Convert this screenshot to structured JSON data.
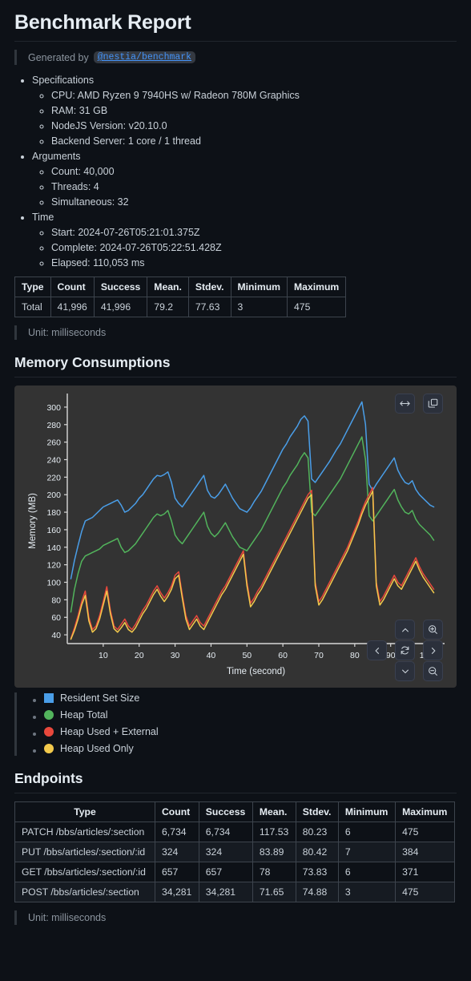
{
  "report": {
    "title": "Benchmark Report",
    "generated_by_label": "Generated by",
    "generated_by_package": "@nestia/benchmark"
  },
  "specifications": {
    "heading": "Specifications",
    "items": [
      "CPU: AMD Ryzen 9 7940HS w/ Radeon 780M Graphics",
      "RAM: 31 GB",
      "NodeJS Version: v20.10.0",
      "Backend Server: 1 core / 1 thread"
    ]
  },
  "arguments": {
    "heading": "Arguments",
    "items": [
      "Count: 40,000",
      "Threads: 4",
      "Simultaneous: 32"
    ]
  },
  "time": {
    "heading": "Time",
    "items": [
      "Start: 2024-07-26T05:21:01.375Z",
      "Complete: 2024-07-26T05:22:51.428Z",
      "Elapsed: 110,053 ms"
    ]
  },
  "summary_table": {
    "columns": [
      "Type",
      "Count",
      "Success",
      "Mean.",
      "Stdev.",
      "Minimum",
      "Maximum"
    ],
    "rows": [
      [
        "Total",
        "41,996",
        "41,996",
        "79.2",
        "77.63",
        "3",
        "475"
      ]
    ],
    "unit_note": "Unit: milliseconds"
  },
  "memory": {
    "heading": "Memory Consumptions",
    "toolbar": {
      "resize_label": "resize",
      "copy_label": "copy"
    },
    "nav": {
      "up": "up",
      "down": "down",
      "left": "left",
      "right": "right",
      "reset": "reset",
      "zoom_in": "zoom in",
      "zoom_out": "zoom out"
    },
    "legend": [
      {
        "label": "Resident Set Size",
        "color": "#4a9ee8",
        "shape": "square"
      },
      {
        "label": "Heap Total",
        "color": "#52b45c",
        "shape": "circle"
      },
      {
        "label": "Heap Used + External",
        "color": "#e8483c",
        "shape": "circle"
      },
      {
        "label": "Heap Used Only",
        "color": "#f2c94c",
        "shape": "circle"
      }
    ]
  },
  "chart_data": {
    "type": "line",
    "title": "Memory Consumptions",
    "xlabel": "Time (second)",
    "ylabel": "Memory (MB)",
    "xlim": [
      0,
      105
    ],
    "ylim": [
      30,
      310
    ],
    "xticks": [
      10,
      20,
      30,
      40,
      50,
      60,
      70,
      80,
      90,
      100
    ],
    "yticks": [
      40,
      60,
      80,
      100,
      120,
      140,
      160,
      180,
      200,
      220,
      240,
      260,
      280,
      300
    ],
    "grid": false,
    "legend_position": "below",
    "x": [
      1,
      2,
      3,
      4,
      5,
      6,
      7,
      8,
      9,
      10,
      11,
      12,
      13,
      14,
      15,
      16,
      17,
      18,
      19,
      20,
      21,
      22,
      23,
      24,
      25,
      26,
      27,
      28,
      29,
      30,
      31,
      32,
      33,
      34,
      35,
      36,
      37,
      38,
      39,
      40,
      41,
      42,
      43,
      44,
      45,
      46,
      47,
      48,
      49,
      50,
      51,
      52,
      53,
      54,
      55,
      56,
      57,
      58,
      59,
      60,
      61,
      62,
      63,
      64,
      65,
      66,
      67,
      68,
      69,
      70,
      71,
      72,
      73,
      74,
      75,
      76,
      77,
      78,
      79,
      80,
      81,
      82,
      83,
      84,
      85,
      86,
      87,
      88,
      89,
      90,
      91,
      92,
      93,
      94,
      95,
      96,
      97,
      98,
      99,
      100,
      101,
      102
    ],
    "series": [
      {
        "name": "Resident Set Size",
        "color": "#4a9ee8",
        "values": [
          104,
          125,
          142,
          158,
          170,
          172,
          174,
          178,
          182,
          186,
          188,
          190,
          192,
          194,
          188,
          180,
          182,
          186,
          190,
          196,
          200,
          206,
          212,
          218,
          222,
          221,
          223,
          226,
          214,
          196,
          190,
          186,
          192,
          198,
          204,
          210,
          216,
          222,
          205,
          198,
          196,
          200,
          206,
          212,
          204,
          196,
          190,
          184,
          182,
          180,
          185,
          192,
          198,
          204,
          212,
          220,
          228,
          236,
          244,
          252,
          258,
          266,
          272,
          278,
          286,
          290,
          284,
          218,
          214,
          220,
          226,
          232,
          238,
          245,
          252,
          258,
          266,
          274,
          282,
          290,
          298,
          306,
          280,
          212,
          205,
          212,
          218,
          224,
          230,
          236,
          242,
          228,
          220,
          214,
          212,
          216,
          206,
          200,
          196,
          192,
          188,
          186
        ]
      },
      {
        "name": "Heap Total",
        "color": "#52b45c",
        "values": [
          66,
          92,
          110,
          124,
          130,
          132,
          134,
          136,
          138,
          142,
          144,
          146,
          148,
          150,
          140,
          134,
          136,
          140,
          144,
          150,
          156,
          162,
          168,
          174,
          178,
          176,
          178,
          182,
          170,
          154,
          148,
          144,
          150,
          156,
          162,
          168,
          174,
          180,
          164,
          156,
          152,
          156,
          162,
          168,
          160,
          152,
          146,
          140,
          138,
          136,
          142,
          148,
          154,
          160,
          168,
          176,
          184,
          192,
          200,
          208,
          214,
          222,
          228,
          234,
          242,
          248,
          242,
          180,
          176,
          182,
          188,
          194,
          200,
          206,
          212,
          218,
          226,
          234,
          242,
          250,
          258,
          266,
          240,
          176,
          170,
          176,
          182,
          188,
          194,
          200,
          206,
          194,
          186,
          180,
          178,
          182,
          172,
          166,
          162,
          158,
          154,
          148
        ]
      },
      {
        "name": "Heap Used + External",
        "color": "#e8483c",
        "values": [
          36,
          48,
          62,
          78,
          90,
          60,
          46,
          50,
          62,
          78,
          95,
          68,
          50,
          46,
          52,
          58,
          50,
          46,
          52,
          60,
          68,
          74,
          82,
          90,
          96,
          88,
          82,
          88,
          96,
          108,
          112,
          86,
          62,
          50,
          56,
          62,
          54,
          50,
          58,
          66,
          74,
          82,
          90,
          96,
          104,
          112,
          120,
          128,
          136,
          100,
          76,
          82,
          90,
          96,
          104,
          112,
          120,
          128,
          136,
          144,
          152,
          160,
          168,
          176,
          184,
          192,
          200,
          205,
          100,
          78,
          84,
          92,
          100,
          108,
          116,
          124,
          132,
          140,
          150,
          160,
          170,
          182,
          192,
          200,
          208,
          100,
          78,
          84,
          92,
          100,
          108,
          100,
          96,
          104,
          112,
          120,
          128,
          118,
          110,
          104,
          98,
          92
        ]
      },
      {
        "name": "Heap Used Only",
        "color": "#f2c94c",
        "values": [
          35,
          45,
          58,
          74,
          85,
          56,
          43,
          47,
          58,
          74,
          90,
          64,
          47,
          43,
          48,
          54,
          46,
          43,
          48,
          56,
          64,
          70,
          78,
          86,
          92,
          84,
          78,
          84,
          92,
          104,
          108,
          82,
          58,
          46,
          52,
          58,
          50,
          46,
          54,
          62,
          70,
          78,
          86,
          92,
          100,
          108,
          116,
          124,
          132,
          96,
          72,
          78,
          86,
          92,
          100,
          108,
          116,
          124,
          132,
          140,
          148,
          156,
          164,
          172,
          180,
          188,
          196,
          200,
          96,
          74,
          80,
          88,
          96,
          104,
          112,
          120,
          128,
          136,
          146,
          156,
          166,
          178,
          188,
          196,
          204,
          96,
          74,
          80,
          88,
          96,
          104,
          96,
          92,
          100,
          108,
          116,
          124,
          114,
          106,
          100,
          94,
          88
        ]
      }
    ]
  },
  "endpoints": {
    "heading": "Endpoints",
    "columns": [
      "Type",
      "Count",
      "Success",
      "Mean.",
      "Stdev.",
      "Minimum",
      "Maximum"
    ],
    "rows": [
      [
        "PATCH /bbs/articles/:section",
        "6,734",
        "6,734",
        "117.53",
        "80.23",
        "6",
        "475"
      ],
      [
        "PUT /bbs/articles/:section/:id",
        "324",
        "324",
        "83.89",
        "80.42",
        "7",
        "384"
      ],
      [
        "GET /bbs/articles/:section/:id",
        "657",
        "657",
        "78",
        "73.83",
        "6",
        "371"
      ],
      [
        "POST /bbs/articles/:section",
        "34,281",
        "34,281",
        "71.65",
        "74.88",
        "3",
        "475"
      ]
    ],
    "unit_note": "Unit: milliseconds"
  }
}
